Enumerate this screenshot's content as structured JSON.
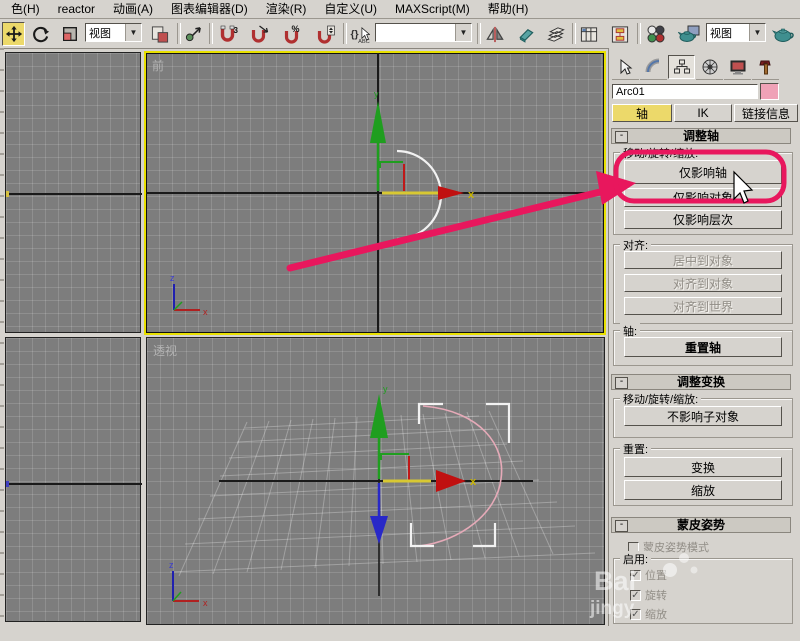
{
  "menu": {
    "items": [
      "色(H)",
      "reactor",
      "动画(A)",
      "图表编辑器(D)",
      "渲染(R)",
      "自定义(U)",
      "MAXScript(M)",
      "帮助(H)"
    ]
  },
  "toolbar": {
    "ref_coord_value": "视图",
    "render_type_value": "视图",
    "named_selection_value": "",
    "snap_badge_3": "3",
    "snap_badge_percent": "%",
    "combo_arrow": "▼"
  },
  "viewports": {
    "front": {
      "label": "前"
    },
    "perspective": {
      "label": "透视"
    },
    "axis": {
      "x": "x",
      "y": "y",
      "z": "z",
      "x_upper": "X",
      "z_upper": "Z"
    }
  },
  "panel": {
    "object_name": "Arc01",
    "modes": {
      "pivot": "轴",
      "ik": "IK",
      "link_info": "链接信息"
    },
    "adjust_pivot": {
      "title": "调整轴",
      "collapse": "-",
      "mrs_label": "移动/旋转/缩放:",
      "affect_pivot": "仅影响轴",
      "affect_object": "仅影响对象",
      "affect_hierarchy": "仅影响层次",
      "align_label": "对齐:",
      "center_to_object": "居中到对象",
      "align_to_object": "对齐到对象",
      "align_to_world": "对齐到世界",
      "pivot_label": "轴:",
      "reset_pivot": "重置轴"
    },
    "adjust_transform": {
      "title": "调整变换",
      "collapse": "-",
      "mrs_label": "移动/旋转/缩放:",
      "dont_affect_children": "不影响子对象",
      "reset_label": "重置:",
      "transform_btn": "变换",
      "scale_btn": "缩放"
    },
    "skin_pose": {
      "title": "蒙皮姿势",
      "collapse": "-",
      "mode_label": "蒙皮姿势模式",
      "enable_label": "启用:",
      "position_label": "位置",
      "rotation_label": "旋转",
      "scale_label": "缩放",
      "check_glyph": "✓"
    }
  },
  "annotation": {
    "color": "#e8175d"
  },
  "watermark": {
    "line1": "Bai",
    "line2": "jingy"
  },
  "colors": {
    "accent_yellow": "#ecd96a",
    "active_viewport_border": "#e8e000",
    "viewport_bg": "#7d7d7d",
    "panel_bg": "#d6d3ce",
    "swatch_pink": "#efa2b7"
  }
}
